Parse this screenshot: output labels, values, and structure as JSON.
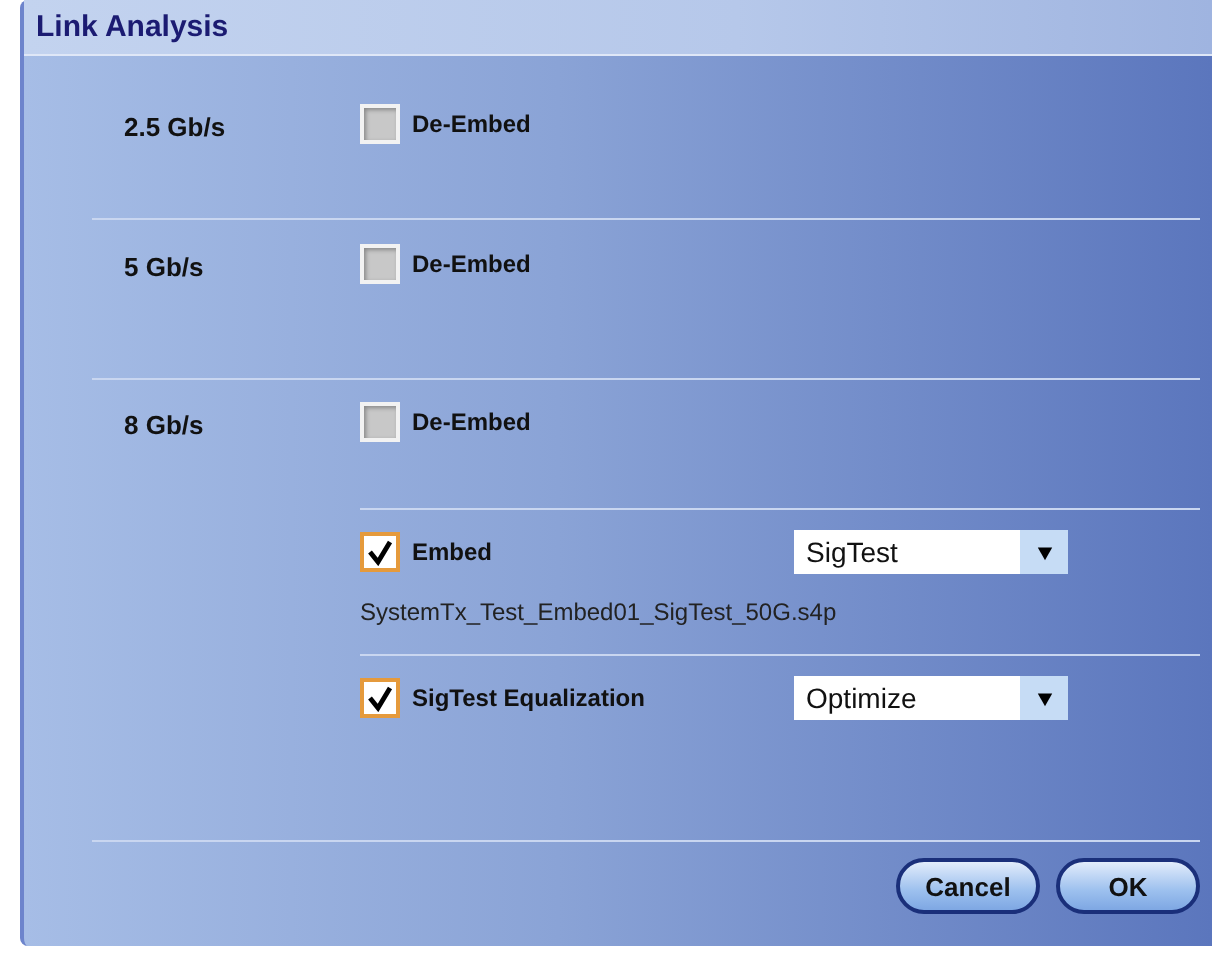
{
  "window": {
    "title": "Link Analysis"
  },
  "rates": [
    {
      "label": "2.5 Gb/s",
      "deembed": {
        "label": "De-Embed",
        "checked": false
      }
    },
    {
      "label": "5 Gb/s",
      "deembed": {
        "label": "De-Embed",
        "checked": false
      }
    },
    {
      "label": "8 Gb/s",
      "deembed": {
        "label": "De-Embed",
        "checked": false
      }
    }
  ],
  "options": [
    {
      "label": "Embed",
      "checked": true,
      "dropdown": "SigTest",
      "file": "SystemTx_Test_Embed01_SigTest_50G.s4p"
    },
    {
      "label": "SigTest Equalization",
      "checked": true,
      "dropdown": "Optimize"
    }
  ],
  "buttons": [
    "Cancel",
    "OK"
  ]
}
